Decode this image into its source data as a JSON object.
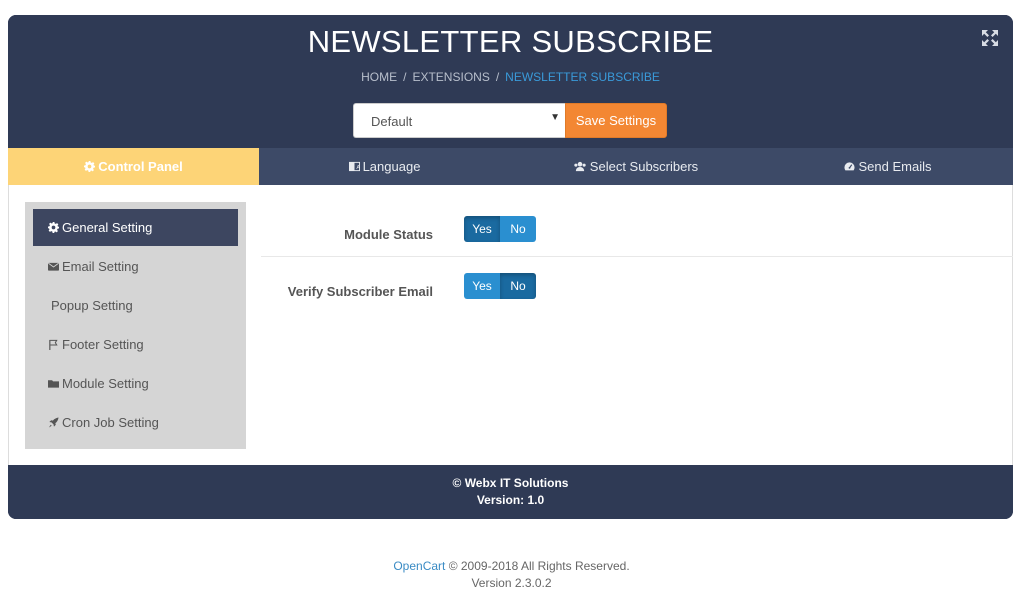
{
  "header": {
    "title": "NEWSLETTER SUBSCRIBE",
    "breadcrumb": [
      "HOME",
      "EXTENSIONS",
      "NEWSLETTER SUBSCRIBE"
    ],
    "separator": "/",
    "store_select": {
      "value": "Default",
      "caret": "▼"
    },
    "save_label": "Save Settings"
  },
  "tabs": [
    {
      "label": "Control Panel",
      "icon": "gear-icon"
    },
    {
      "label": "Language",
      "icon": "language-icon"
    },
    {
      "label": "Select Subscribers",
      "icon": "users-icon"
    },
    {
      "label": "Send Emails",
      "icon": "dashboard-icon"
    }
  ],
  "sidebar": {
    "items": [
      {
        "label": "General Setting",
        "icon": "gear-icon"
      },
      {
        "label": "Email Setting",
        "icon": "envelope-icon"
      },
      {
        "label": "Popup Setting",
        "icon": ""
      },
      {
        "label": "Footer Setting",
        "icon": "flag-icon"
      },
      {
        "label": "Module Setting",
        "icon": "folder-icon"
      },
      {
        "label": "Cron Job Setting",
        "icon": "rocket-icon"
      }
    ]
  },
  "settings": {
    "module_status": {
      "label": "Module Status",
      "yes": "Yes",
      "no": "No",
      "selected": "Yes"
    },
    "verify_email": {
      "label": "Verify Subscriber Email",
      "yes": "Yes",
      "no": "No",
      "selected": "No"
    }
  },
  "footer": {
    "copyright": "© Webx IT Solutions",
    "version": "Version: 1.0"
  },
  "page_footer": {
    "link": "OpenCart",
    "rights": " © 2009-2018 All Rights Reserved.",
    "version": "Version 2.3.0.2"
  },
  "colors": {
    "header_bg": "#2f3a55",
    "tab_active": "#fdd477",
    "save_button": "#f38733",
    "toggle_on": "#1a6aa0",
    "toggle_off": "#2a8fd0"
  }
}
